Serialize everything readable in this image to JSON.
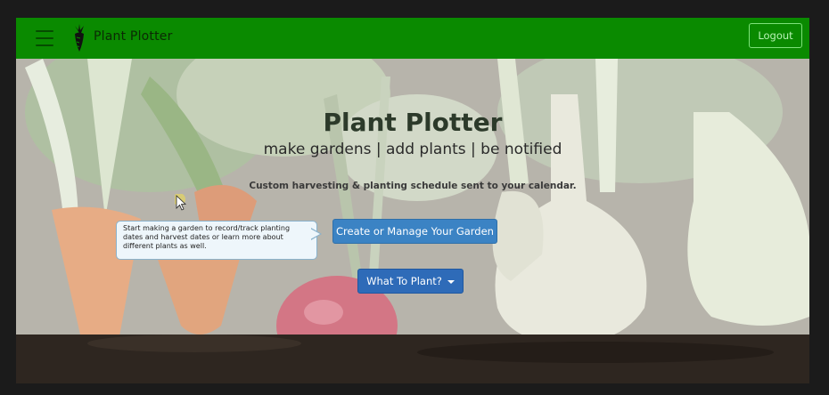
{
  "navbar": {
    "brand": "Plant Plotter",
    "logout_label": "Logout",
    "color": "#0a8a00"
  },
  "hero": {
    "title": "Plant Plotter",
    "subtitle": "make gardens | add plants | be notified",
    "tagline": "Custom harvesting & planting schedule sent to your calendar.",
    "create_button": "Create or Manage Your Garden",
    "what_to_plant_button": "What To Plant?"
  },
  "tooltip": {
    "text": "Start making a garden to record/track planting dates and harvest dates or learn more about different plants as well."
  },
  "icons": {
    "menu": "hamburger-icon",
    "logo": "carrot-logo-icon",
    "dropdown": "caret-down-icon",
    "cursor": "mouse-cursor-icon"
  }
}
